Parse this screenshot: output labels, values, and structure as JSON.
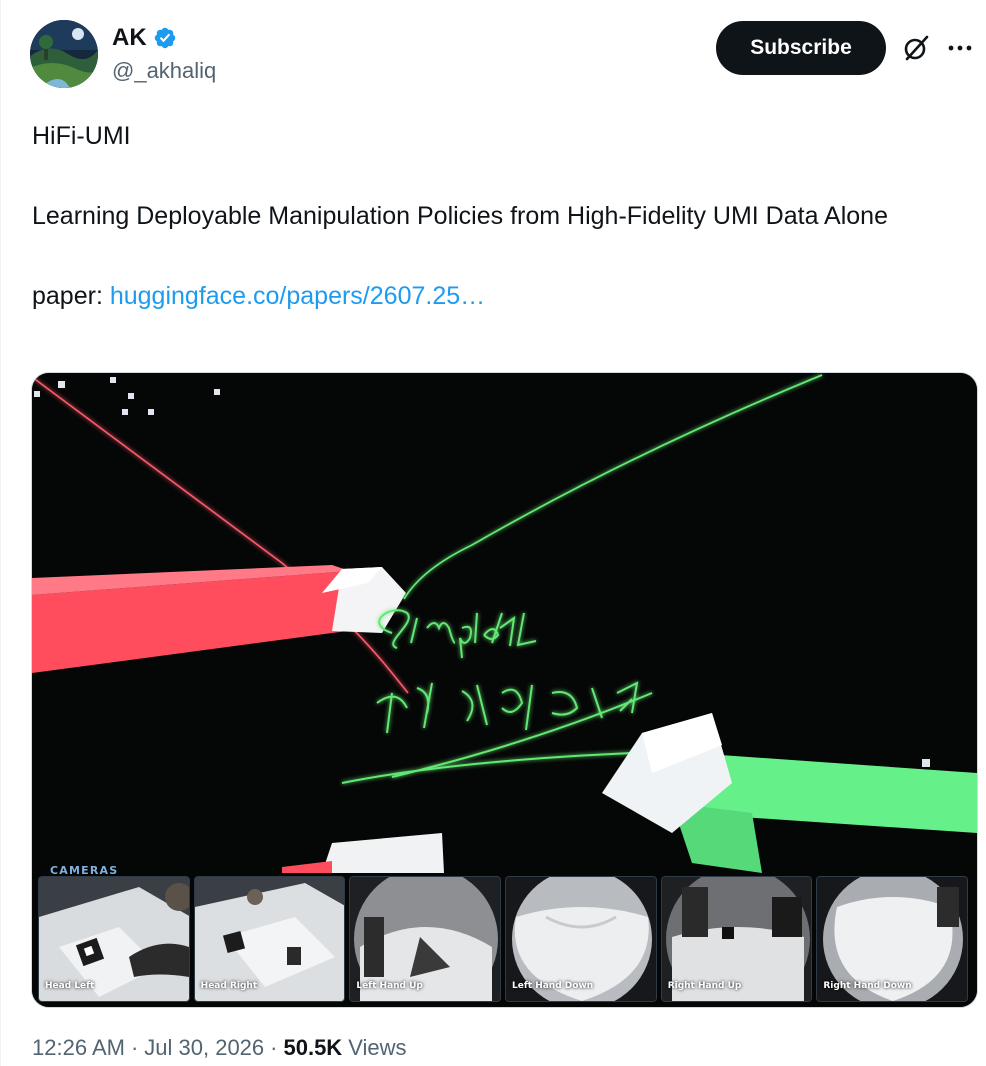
{
  "author": {
    "display_name": "AK",
    "handle": "@_akhaliq",
    "verified": true,
    "avatar_icon": "avatar-landscape"
  },
  "actions": {
    "subscribe_label": "Subscribe",
    "grok_icon": "grok-icon",
    "more_icon": "more-icon"
  },
  "tweet": {
    "title": "HiFi-UMI",
    "subtitle": "Learning Deployable Manipulation Policies from High-Fidelity UMI Data Alone",
    "paper_prefix": "paper: ",
    "paper_link": "huggingface.co/papers/2607.25…"
  },
  "media": {
    "overlay_text_line1": "SimpleAI",
    "overlay_text_line2": "深朴智能",
    "cameras_label": "CAMERAS",
    "cameras": [
      {
        "label": "Head Left"
      },
      {
        "label": "Head Right"
      },
      {
        "label": "Left Hand Up"
      },
      {
        "label": "Left Hand Down"
      },
      {
        "label": "Right Hand Up"
      },
      {
        "label": "Right Hand Down"
      }
    ],
    "colors": {
      "left_hand": "#ff4d5e",
      "right_hand": "#66f08a",
      "trail": "#62e873",
      "background": "#050606"
    }
  },
  "footer": {
    "time": "12:26 AM",
    "separator": "·",
    "date": "Jul 30, 2026",
    "views_count": "50.5K",
    "views_label": "Views"
  },
  "colors": {
    "link": "#1d9bf0",
    "subscribe_bg": "#0f1419",
    "verified": "#1d9bf0",
    "secondary_text": "#536471"
  }
}
